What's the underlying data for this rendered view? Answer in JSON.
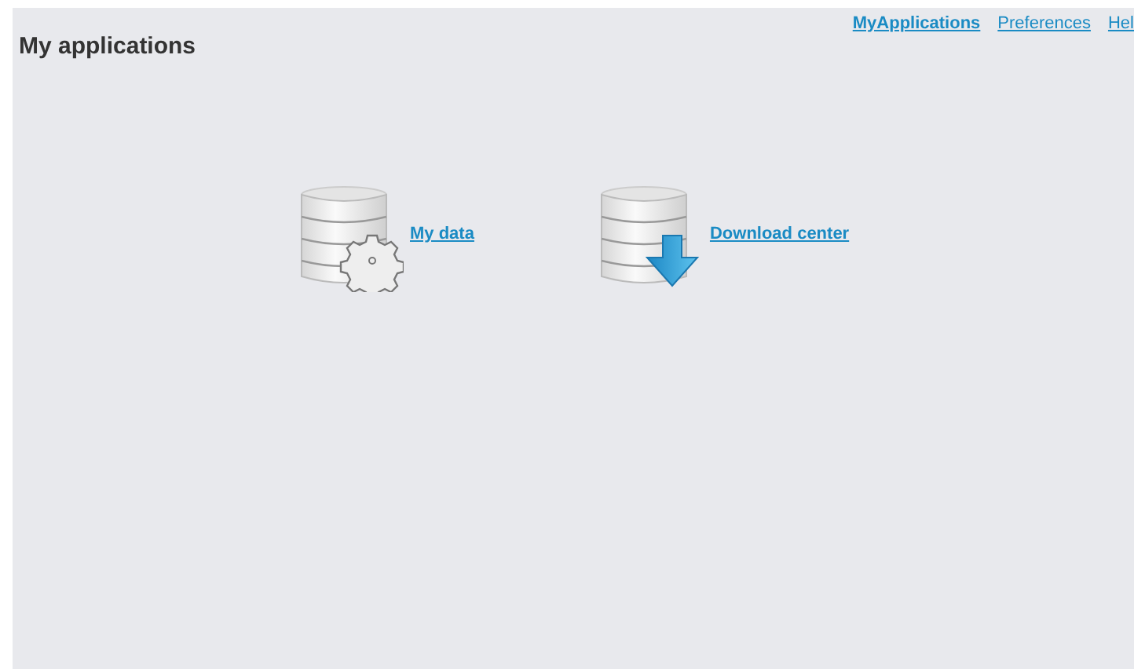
{
  "page": {
    "title": "My applications"
  },
  "nav_links": [
    {
      "label": "MyApplications",
      "selected": true
    },
    {
      "label": "Preferences",
      "selected": false
    },
    {
      "label": "Hel",
      "selected": false
    }
  ],
  "applications": [
    {
      "label": "My data",
      "kind": "data"
    },
    {
      "label": "Download center",
      "kind": "download"
    }
  ]
}
